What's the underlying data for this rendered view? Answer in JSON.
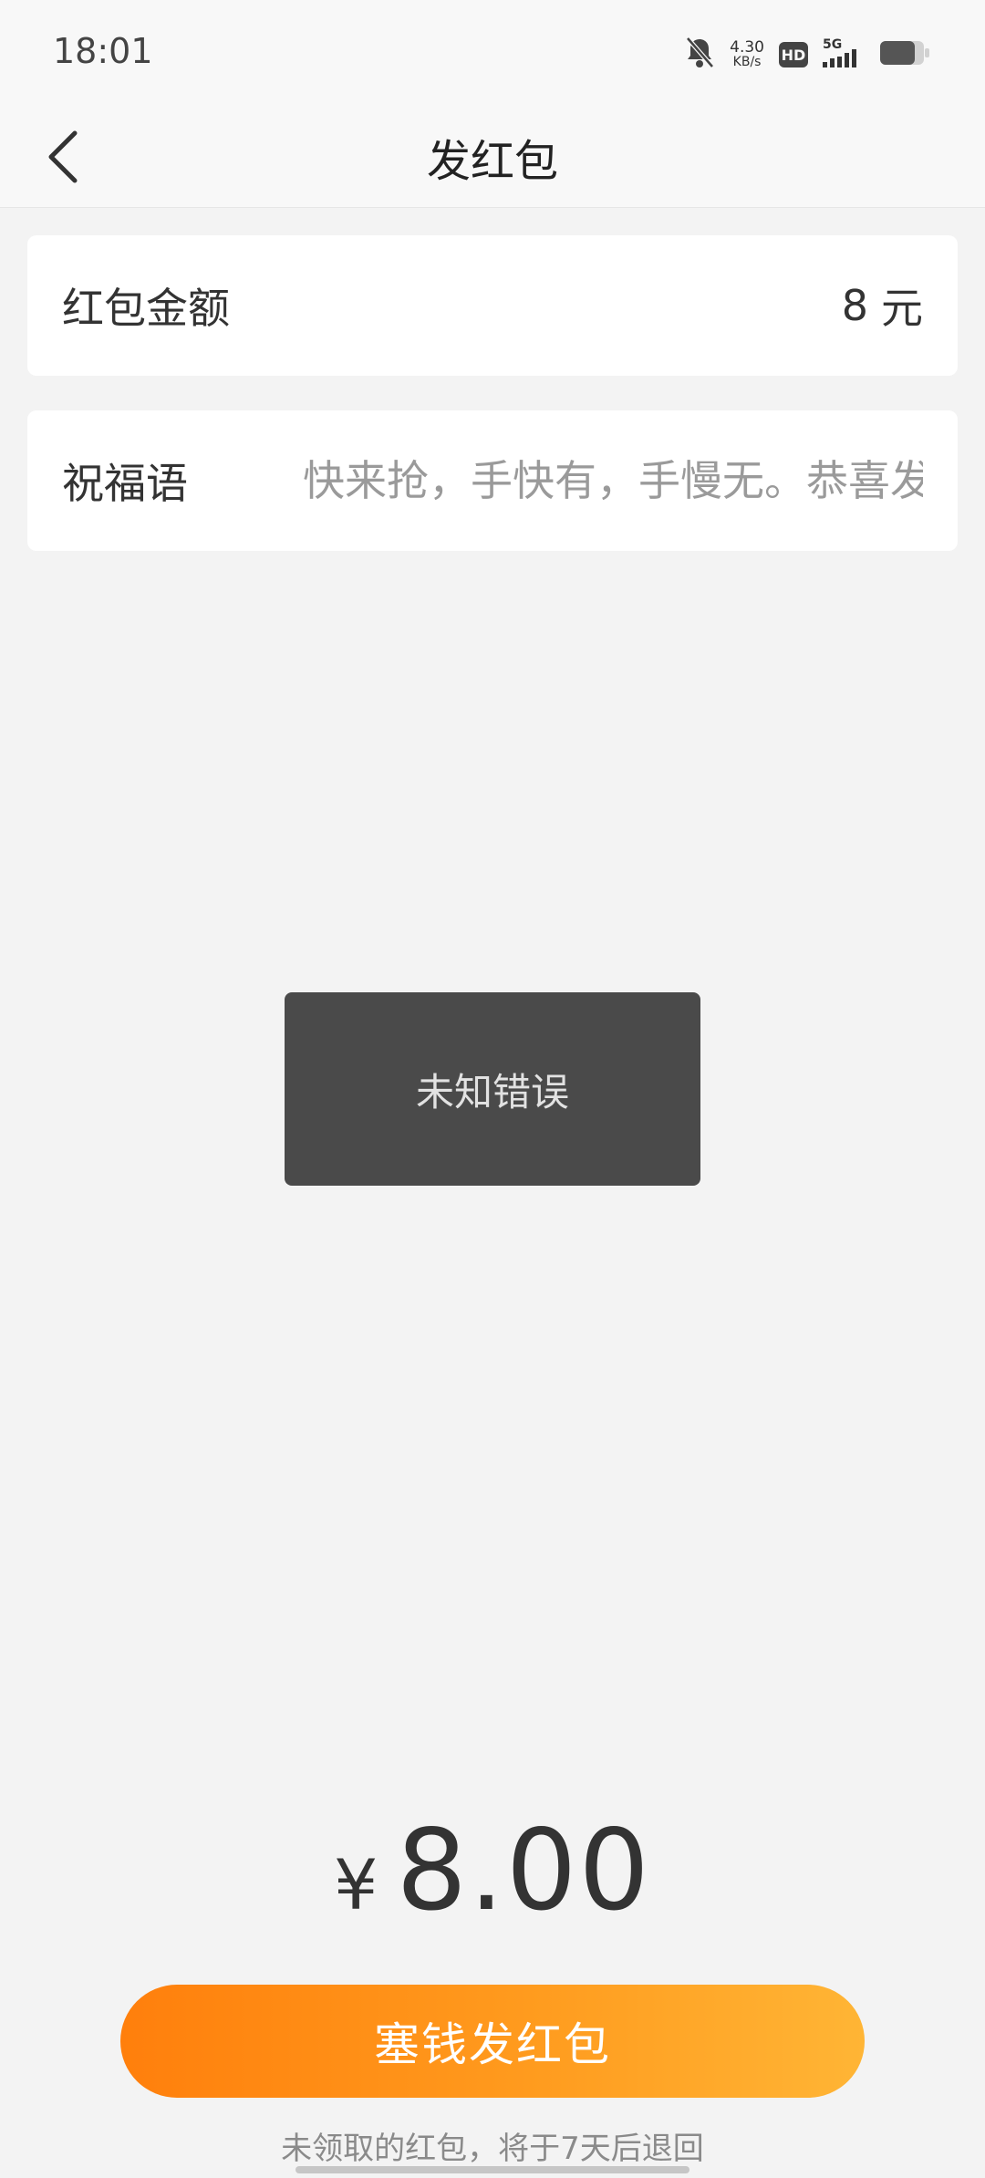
{
  "status_bar": {
    "time": "18:01",
    "net_speed_value": "4.30",
    "net_speed_unit": "KB/s",
    "hd_label": "HD",
    "network_label": "5G",
    "icons": [
      "bell-muted-icon",
      "hd-icon",
      "signal-5g-icon",
      "battery-icon"
    ]
  },
  "nav": {
    "back_icon": "chevron-left-icon",
    "title": "发红包"
  },
  "amount_row": {
    "label": "红包金额",
    "value": "8",
    "unit": "元"
  },
  "greeting_row": {
    "label": "祝福语",
    "placeholder": "快来抢，手快有，手慢无。恭喜发财"
  },
  "toast": {
    "message": "未知错误"
  },
  "total": {
    "currency": "¥",
    "amount": "8.00"
  },
  "send_button": {
    "label": "塞钱发红包"
  },
  "refund_note": "未领取的红包，将于7天后退回",
  "colors": {
    "accent_start": "#ff7f0c",
    "accent_end": "#ffb535",
    "background": "#f3f3f3",
    "toast_bg": "#4a4a4a"
  }
}
